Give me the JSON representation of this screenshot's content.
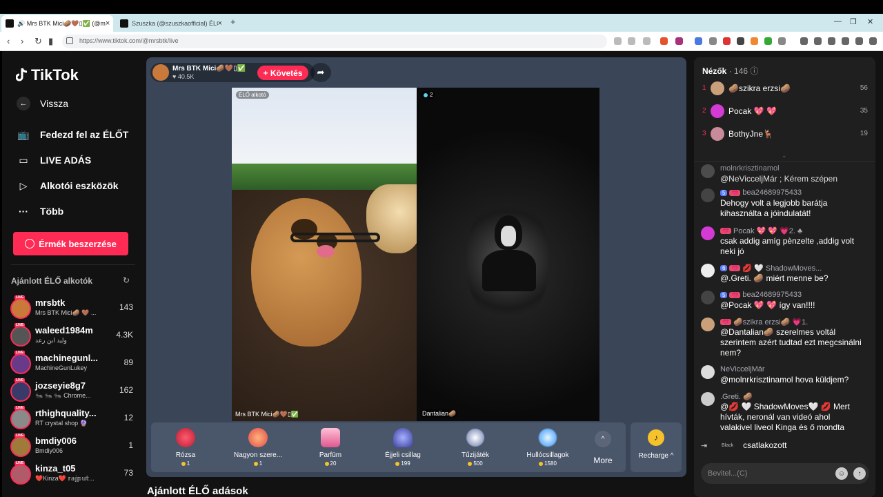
{
  "browser": {
    "tabs": [
      {
        "title": "🔊 Mrs BTK Mici🥔🤎▯✅ (@m",
        "close": "×"
      },
      {
        "title": "Szuszka (@szuszkaofficial) ÉLŐ adás",
        "close": "×"
      }
    ],
    "new_tab": "+",
    "url": "https://www.tiktok.com/@mrsbtk/live"
  },
  "sidebar": {
    "logo": "TikTok",
    "nav": [
      {
        "label": "Vissza",
        "icon": "back-arrow-icon"
      },
      {
        "label": "Fedezd fel az ÉLŐT",
        "icon": "live-tv-icon"
      },
      {
        "label": "LIVE ADÁS",
        "icon": "camera-icon"
      },
      {
        "label": "Alkotói eszközök",
        "icon": "creator-tools-icon"
      },
      {
        "label": "Több",
        "icon": "more-dots-icon"
      }
    ],
    "coins_button": "Érmék beszerzése",
    "suggested_title": "Ajánlott ÉLŐ alkotók",
    "creators": [
      {
        "name": "mrsbtk",
        "sub": "Mrs BTK Mici🥔 🤎 ...",
        "count": "143",
        "color": "#c97a3a"
      },
      {
        "name": "waleed1984m",
        "sub": "وليد ابن رعد",
        "count": "4.3K",
        "color": "#555"
      },
      {
        "name": "machinegunl...",
        "sub": "MachineGunLukey",
        "count": "89",
        "color": "#6a3a8a"
      },
      {
        "name": "jozseyie8g7",
        "sub": "🐜 🐜 🐜 Chrome...",
        "count": "162",
        "color": "#3a3a6a"
      },
      {
        "name": "rthighquality...",
        "sub": "RT crystal shop 🔮",
        "count": "12",
        "color": "#8a8a8a"
      },
      {
        "name": "bmdiy006",
        "sub": "Bmdiy006",
        "count": "1",
        "color": "#a07a3a"
      },
      {
        "name": "kinza_t05",
        "sub": "❤️Kinza❤️ 𝕣𝕒𝕛𝕡𝕦𝕥...",
        "count": "73",
        "color": "#b05a6a"
      }
    ],
    "live_tag": "LIVE"
  },
  "stream": {
    "host_name": "Mrs BTK Mici🥔🤎▯✅",
    "host_likes": "♥ 40.5K",
    "follow": "+ Követés",
    "left_badge": "ÉLŐ alkotó",
    "left_label": "Mrs BTK Mici🥔🤎▯✅",
    "right_count": "2",
    "right_label": "Dantalian🥔",
    "gifts": [
      {
        "name": "Rózsa",
        "price": "1",
        "color": "#e0334a"
      },
      {
        "name": "Nagyon szere...",
        "price": "1",
        "color": "#f06a4a"
      },
      {
        "name": "Parfüm",
        "price": "20",
        "color": "#f38fb3"
      },
      {
        "name": "Éjjeli csillag",
        "price": "199",
        "color": "#6b7be6"
      },
      {
        "name": "Tűzijáték",
        "price": "500",
        "color": "#d8d8f0"
      },
      {
        "name": "Hullócsillagok",
        "price": "1580",
        "color": "#9fd2ff"
      }
    ],
    "more": "More",
    "recharge": "Recharge ^",
    "section_title": "Ajánlott ÉLŐ adások"
  },
  "chat": {
    "viewers_label": "Nézők",
    "viewers_count": "· 146",
    "top_viewers": [
      {
        "rank": "1",
        "name": "🥔szikra erzsi🥔",
        "score": "56",
        "color": "#c9a07a"
      },
      {
        "rank": "2",
        "name": "Pocak 💖 💖",
        "score": "35",
        "color": "#d43ad4"
      },
      {
        "rank": "3",
        "name": "BothyJne🦌",
        "score": "19",
        "color": "#c98a9a"
      }
    ],
    "messages": [
      {
        "user": "molnrkrisztinamol",
        "tags": [],
        "text": "@NeVicceljMár ; Kérem szépen"
      },
      {
        "user": "bea24689975433",
        "tags": [
          "5",
          "💗"
        ],
        "text": "Dehogy volt a legjobb barátja kihasználta a jóindulatát!"
      },
      {
        "user": "Pocak 💖 💖 💗2. ♣",
        "tags": [
          "💗"
        ],
        "text": "csak addig amíg pènzelte ,addig volt neki jó"
      },
      {
        "user": "💋 🤍 ShadowMoves...",
        "tags": [
          "6",
          "💗"
        ],
        "text": "@.Greti. 🥔 miért menne be?"
      },
      {
        "user": "bea24689975433",
        "tags": [
          "5",
          "💗"
        ],
        "text": "@Pocak 💖 💖 így van!!!!"
      },
      {
        "user": "🥔szikra erzsi🥔 💗1.",
        "tags": [
          "💗"
        ],
        "text": "@Dantalian🥔 szerelmes voltál szerintem azért tudtad ezt megcsinálni nem?"
      },
      {
        "user": "NeVicceljMár",
        "tags": [],
        "text": "@molnrkrisztinamol hova küldjem?"
      },
      {
        "user": ".Greti. 🥔",
        "tags": [],
        "text": "@💋 🤍 ShadowMoves🤍 💋 Mert hívták, neronál van videó ahol valakivel liveol Kinga és ő mondta"
      }
    ],
    "joined_badge": "Black",
    "joined_text": "csatlakozott",
    "input_placeholder": "Bevitel...(C)"
  }
}
